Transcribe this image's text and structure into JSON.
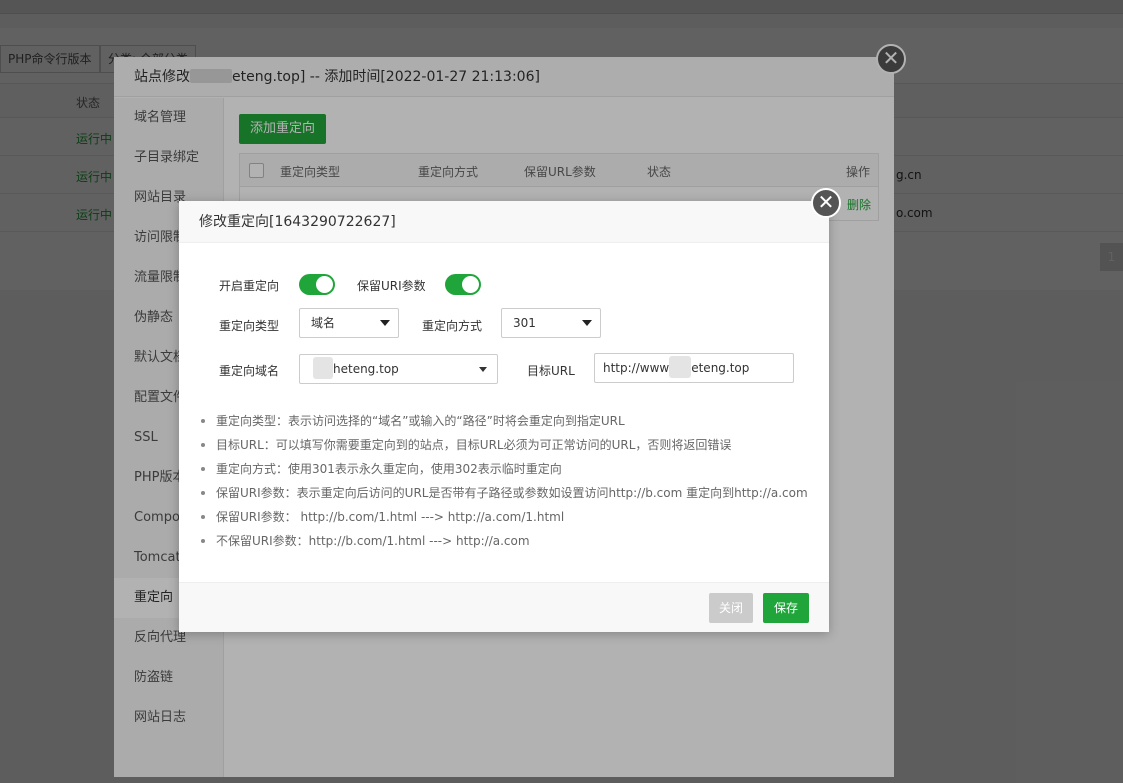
{
  "background": {
    "toolbar": {
      "php_cli_btn": "PHP命令行版本",
      "category_btn": "分类: 全部分类"
    },
    "table": {
      "status_header": "状态",
      "rows": [
        {
          "status": "运行中",
          "domain": ""
        },
        {
          "status": "运行中",
          "domain": "g.cn"
        },
        {
          "status": "运行中",
          "domain": "o.com"
        }
      ]
    },
    "pagination": {
      "page": "1"
    }
  },
  "site_panel": {
    "title_prefix": "站点修改",
    "title_suffix": "eteng.top] -- 添加时间[2022-01-27 21:13:06]",
    "close_glyph": "✕",
    "nav": [
      "域名管理",
      "子目录绑定",
      "网站目录",
      "访问限制",
      "流量限制",
      "伪静态",
      "默认文档",
      "配置文件",
      "SSL",
      "PHP版本",
      "Composer",
      "Tomcat",
      "重定向",
      "反向代理",
      "防盗链",
      "网站日志"
    ],
    "active_nav": "重定向",
    "add_redirect_btn": "添加重定向",
    "redirect_table": {
      "headers": [
        "重定向类型",
        "重定向方式",
        "保留URL参数",
        "状态",
        "操作"
      ],
      "row_action": "删除"
    }
  },
  "dialog": {
    "title": "修改重定向[1643290722627]",
    "close_glyph": "✕",
    "enable_redirect_label": "开启重定向",
    "enable_redirect_on": true,
    "keep_uri_label": "保留URI参数",
    "keep_uri_on": true,
    "redirect_type_label": "重定向类型",
    "redirect_type_value": "域名",
    "redirect_method_label": "重定向方式",
    "redirect_method_value": "301",
    "redirect_domain_label": "重定向域名",
    "redirect_domain_value": "heteng.top",
    "target_url_label": "目标URL",
    "target_url_prefix": "http://www",
    "target_url_suffix": "eteng.top",
    "tips": [
      "重定向类型：表示访问选择的“域名”或输入的“路径”时将会重定向到指定URL",
      "目标URL：可以填写你需要重定向到的站点，目标URL必须为可正常访问的URL，否则将返回错误",
      "重定向方式：使用301表示永久重定向，使用302表示临时重定向",
      "保留URI参数：表示重定向后访问的URL是否带有子路径或参数如设置访问http://b.com 重定向到http://a.com",
      "保留URI参数：  http://b.com/1.html ---> http://a.com/1.html",
      "不保留URI参数：http://b.com/1.html ---> http://a.com"
    ],
    "close_btn": "关闭",
    "save_btn": "保存"
  },
  "colors": {
    "accent": "#20a53a",
    "close_btn_bg": "#cbcbcb",
    "close_circle": "#555555"
  }
}
